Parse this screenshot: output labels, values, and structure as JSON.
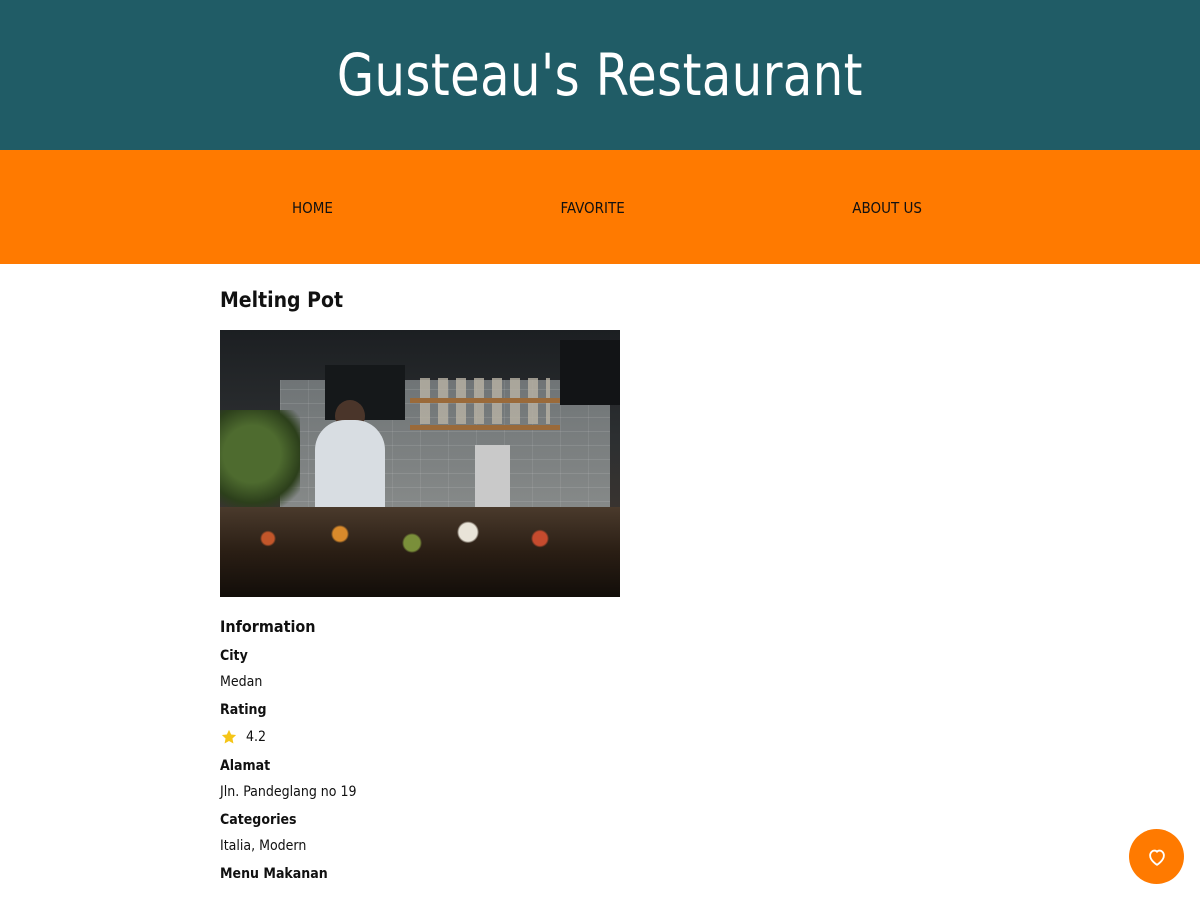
{
  "header": {
    "title": "Gusteau's Restaurant"
  },
  "nav": {
    "items": [
      {
        "label": "HOME"
      },
      {
        "label": "FAVORITE"
      },
      {
        "label": "ABOUT US"
      }
    ]
  },
  "restaurant": {
    "name": "Melting Pot",
    "image_alt": "Melting Pot",
    "information_title": "Information",
    "city": {
      "label": "City",
      "value": "Medan"
    },
    "rating": {
      "label": "Rating",
      "value": "4.2"
    },
    "address": {
      "label": "Alamat",
      "value": "Jln. Pandeglang no 19"
    },
    "categories": {
      "label": "Categories",
      "value": "Italia, Modern"
    },
    "menu_food": {
      "label": "Menu Makanan"
    }
  },
  "favorite_button": {
    "icon": "heart-outline-icon",
    "aria_label": "like this restaurant"
  },
  "colors": {
    "header_bg": "#205c66",
    "nav_bg": "#ff7a00",
    "fab_bg": "#ff7a00",
    "star": "#f5c518"
  }
}
